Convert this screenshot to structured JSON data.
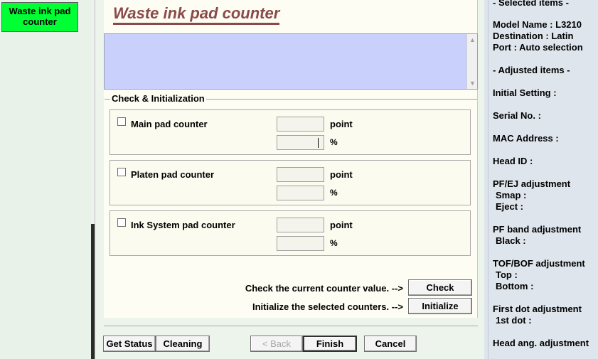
{
  "sidebar": {
    "items": [
      {
        "label": "Waste ink pad counter",
        "line1": "Waste ink pad",
        "line2": "counter",
        "color": "#00ff33"
      }
    ]
  },
  "main": {
    "title": "Waste ink pad counter",
    "group_label": "Check & Initialization",
    "counters": [
      {
        "label": "Main pad counter",
        "checked": false,
        "point_value": "",
        "percent_value": ""
      },
      {
        "label": "Platen pad counter",
        "checked": false,
        "point_value": "",
        "percent_value": ""
      },
      {
        "label": "Ink System pad counter",
        "checked": false,
        "point_value": "",
        "percent_value": ""
      }
    ],
    "unit_point": "point",
    "unit_percent": "%",
    "check_text": "Check the current counter value. -->",
    "check_button": "Check",
    "init_text": "Initialize the selected counters. -->",
    "init_button": "Initialize"
  },
  "footer": {
    "get_status": "Get Status",
    "cleaning": "Cleaning",
    "back": "< Back",
    "finish": "Finish",
    "cancel": "Cancel"
  },
  "info_panel": {
    "selected_header": "- Selected items -",
    "model_name": "Model Name : L3210",
    "destination": "Destination : Latin",
    "port": "Port : Auto selection",
    "adjusted_header": "- Adjusted items -",
    "initial_setting": "Initial Setting :",
    "serial_no": "Serial No. :",
    "mac_address": "MAC Address :",
    "head_id": "Head ID :",
    "pfej": "PF/EJ adjustment",
    "smap": " Smap :",
    "eject": " Eject :",
    "pf_band": "PF band adjustment",
    "black": " Black :",
    "tof_bof": "TOF/BOF adjustment",
    "top": " Top :",
    "bottom": " Bottom :",
    "first_dot": "First dot adjustment",
    "first_dot_val": " 1st dot :",
    "head_ang": "Head ang. adjustment"
  }
}
